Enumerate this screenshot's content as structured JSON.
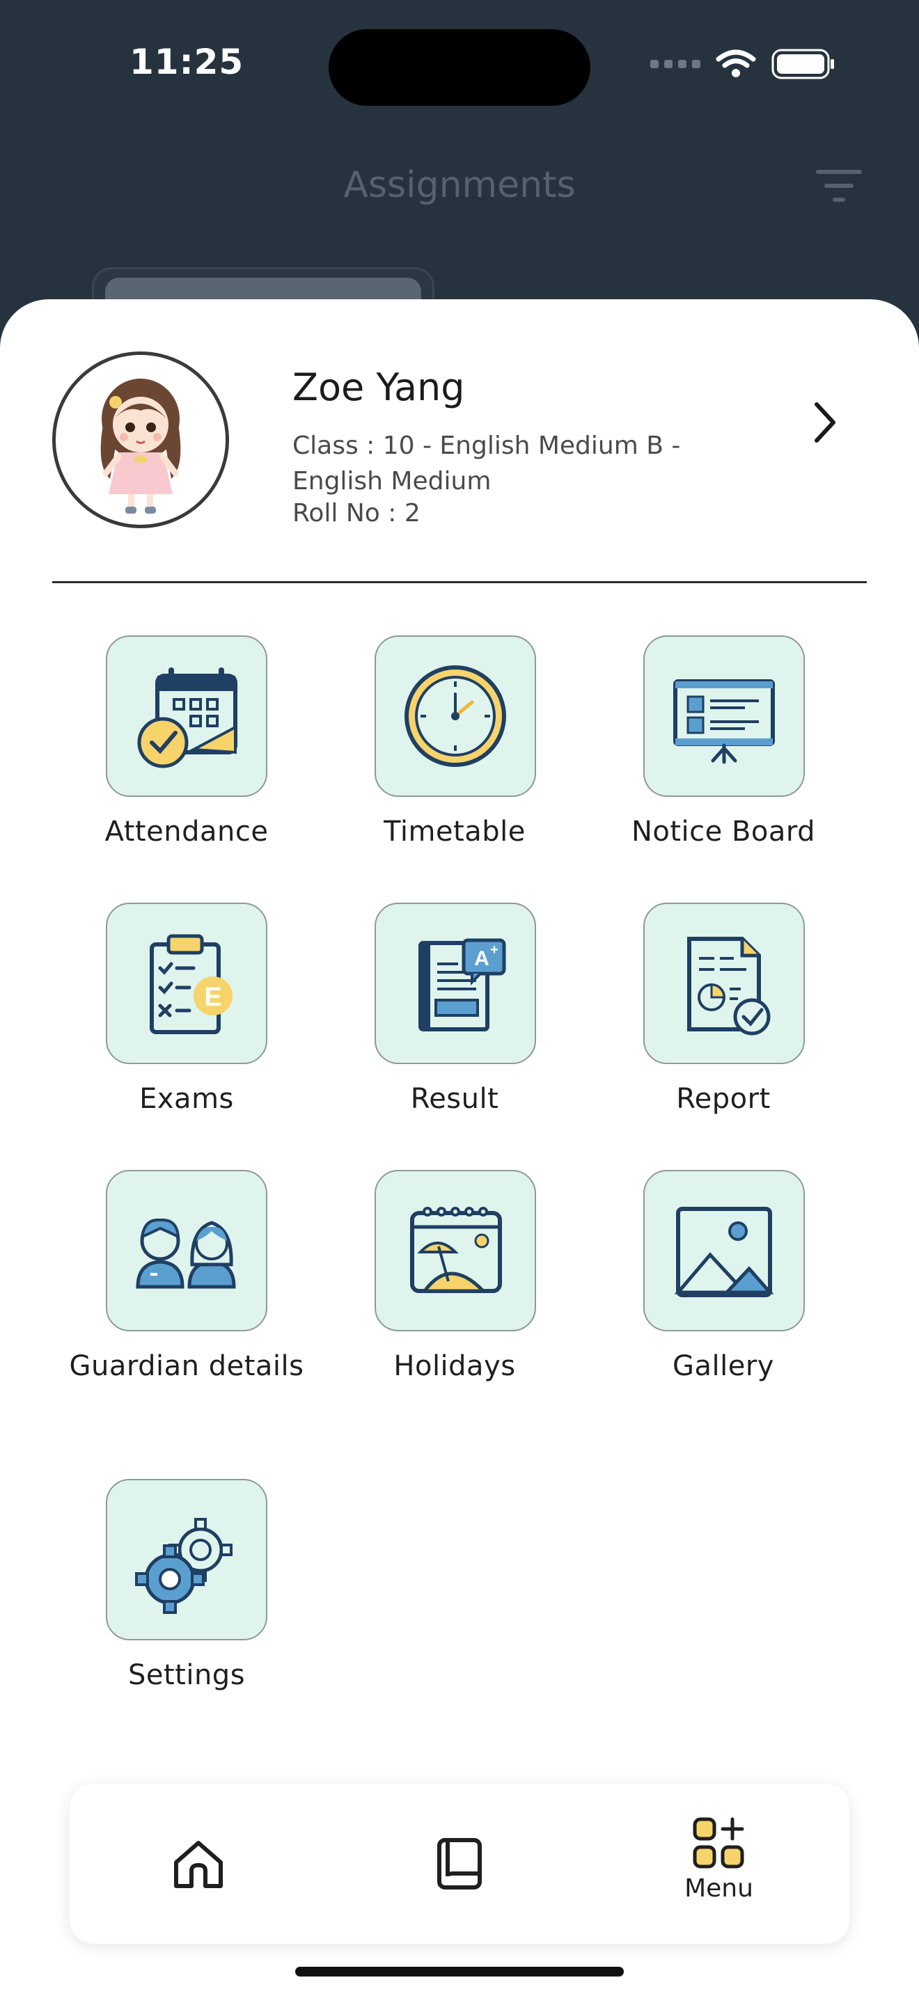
{
  "status_bar": {
    "time": "11:25"
  },
  "header": {
    "title": "Assignments"
  },
  "profile": {
    "name": "Zoe Yang",
    "class_text": "Class : 10 - English Medium B - English Medium",
    "roll_text": "Roll No : 2"
  },
  "menu": {
    "items": [
      {
        "label": "Attendance",
        "icon": "calendar-check-icon"
      },
      {
        "label": "Timetable",
        "icon": "clock-icon"
      },
      {
        "label": "Notice Board",
        "icon": "presentation-board-icon"
      },
      {
        "label": "Exams",
        "icon": "clipboard-checklist-icon"
      },
      {
        "label": "Result",
        "icon": "result-document-icon"
      },
      {
        "label": "Report",
        "icon": "report-chart-icon"
      },
      {
        "label": "Guardian details",
        "icon": "guardians-icon"
      },
      {
        "label": "Holidays",
        "icon": "holiday-calendar-icon"
      },
      {
        "label": "Gallery",
        "icon": "image-icon"
      },
      {
        "label": "Settings",
        "icon": "gears-icon"
      }
    ]
  },
  "bottom_nav": {
    "items": [
      {
        "label": "",
        "icon": "home-icon"
      },
      {
        "label": "",
        "icon": "book-icon"
      },
      {
        "label": "Menu",
        "icon": "menu-grid-icon"
      }
    ]
  },
  "colors": {
    "header_bg": "#26333f",
    "tile_bg": "#dff4ec",
    "icon_navy": "#1f3f63",
    "icon_blue": "#5a9fd0",
    "icon_yellow": "#f6d36b"
  }
}
